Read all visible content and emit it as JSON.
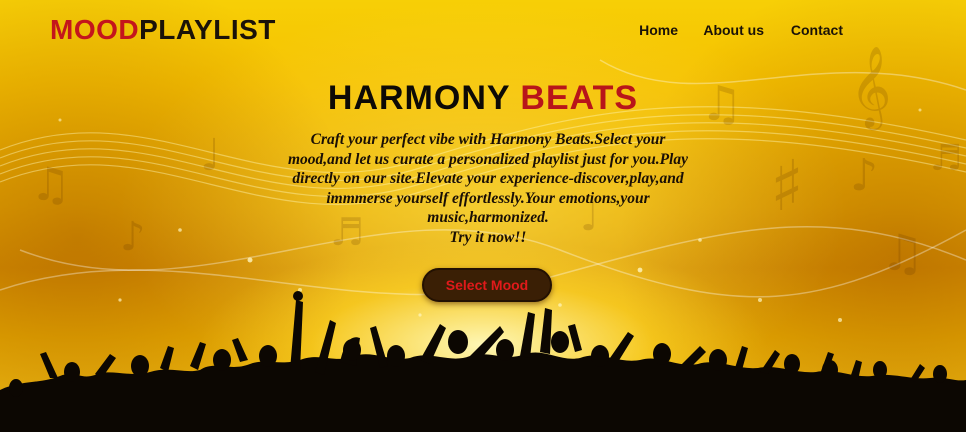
{
  "brand": {
    "part1": "MOOD",
    "part2": "PLAYLIST",
    "color1": "#c4151c",
    "color2": "#1a1208"
  },
  "nav": {
    "items": [
      {
        "label": "Home"
      },
      {
        "label": "About us"
      },
      {
        "label": "Contact"
      }
    ]
  },
  "hero": {
    "title_part1": "HARMONY",
    "title_part2": "BEATS",
    "description": "Craft your perfect vibe with Harmony Beats.Select your mood,and let us curate a personalized playlist just for you.Play directly on our site.Elevate your experience-discover,play,and immmerse yourself effortlessly.Your emotions,your music,harmonized.",
    "cta_text": "Try it now!!",
    "button_label": "Select Mood",
    "background_icon": "music-notes-crowd-icon"
  },
  "colors": {
    "background_accent": "#f5c000",
    "accent_red": "#c4151c",
    "button_bg": "#3a1f05",
    "button_text": "#e01a1a"
  }
}
